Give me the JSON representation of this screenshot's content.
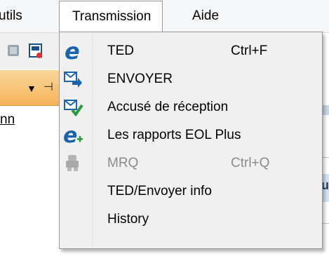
{
  "menubar": {
    "items": [
      {
        "label": "utils"
      },
      {
        "label": "Transmission"
      },
      {
        "label": "Aide"
      }
    ]
  },
  "background": {
    "link_fragment": "nn",
    "right_fragment_char": "u"
  },
  "menu": {
    "items": [
      {
        "label": "TED",
        "shortcut": "Ctrl+F",
        "icon": "ted-e-icon",
        "enabled": true
      },
      {
        "label": "ENVOYER",
        "shortcut": "",
        "icon": "send-envelope-icon",
        "enabled": true
      },
      {
        "label": "Accusé de réception",
        "shortcut": "",
        "icon": "receipt-envelope-check-icon",
        "enabled": true
      },
      {
        "label": "Les rapports  EOL Plus",
        "shortcut": "",
        "icon": "reports-e-plus-icon",
        "enabled": true
      },
      {
        "label": "MRQ",
        "shortcut": "Ctrl+Q",
        "icon": "mrq-icon",
        "enabled": false
      },
      {
        "label": "TED/Envoyer info",
        "shortcut": "",
        "icon": "",
        "enabled": true
      },
      {
        "label": "History",
        "shortcut": "",
        "icon": "",
        "enabled": true
      }
    ]
  },
  "colors": {
    "icon_blue": "#1a64ad",
    "icon_green": "#2a9a3a",
    "disabled_text": "#8a8a8a",
    "menu_bg": "#f0f0f0",
    "orange_panel": "#f5b35a"
  }
}
